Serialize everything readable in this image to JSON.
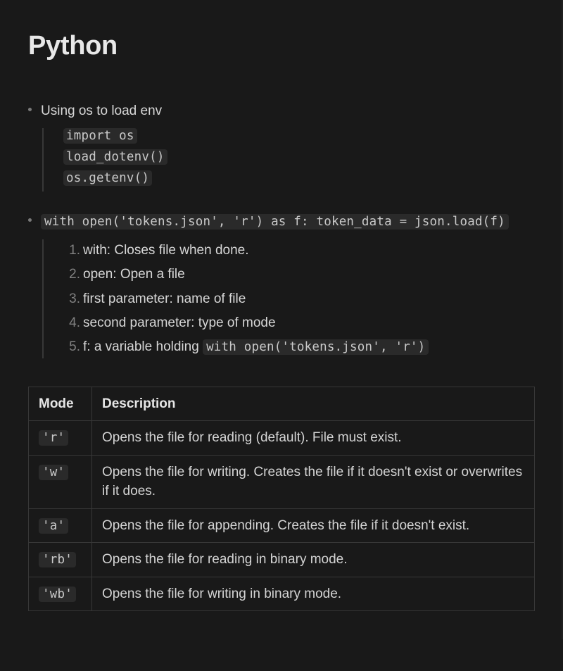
{
  "title": "Python",
  "bullets": [
    {
      "head_text": "Using os to load env",
      "head_is_code": false,
      "code_lines": [
        "import os",
        "load_dotenv()",
        "os.getenv()"
      ]
    },
    {
      "head_text": "with open('tokens.json', 'r') as f: token_data = json.load(f)",
      "head_is_code": true,
      "ordered": [
        {
          "text": "with: Closes file when done."
        },
        {
          "text": "open: Open a file"
        },
        {
          "text": "first parameter: name of file"
        },
        {
          "text": "second parameter: type of mode"
        },
        {
          "text_prefix": "f: a variable holding ",
          "code": "with open('tokens.json', 'r')"
        }
      ]
    }
  ],
  "table": {
    "headers": [
      "Mode",
      "Description"
    ],
    "rows": [
      {
        "mode": "'r'",
        "desc": "Opens the file for reading (default). File must exist."
      },
      {
        "mode": "'w'",
        "desc": "Opens the file for writing. Creates the file if it doesn't exist or overwrites if it does."
      },
      {
        "mode": "'a'",
        "desc": "Opens the file for appending. Creates the file if it doesn't exist."
      },
      {
        "mode": "'rb'",
        "desc": "Opens the file for reading in binary mode."
      },
      {
        "mode": "'wb'",
        "desc": "Opens the file for writing in binary mode."
      }
    ]
  }
}
